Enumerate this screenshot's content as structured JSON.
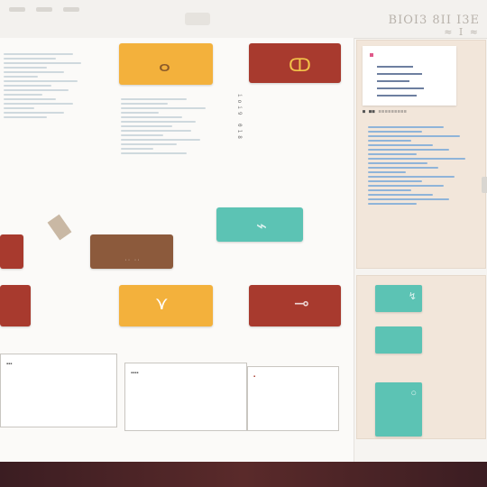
{
  "topbar": {
    "brand_line1": "BIOI3 8II I3E",
    "brand_line2": "≈ I ≈"
  },
  "colors": {
    "card_yellow": "#f3b13c",
    "card_red": "#a83a2e",
    "card_brown": "#8c5a3c",
    "card_teal": "#5cc3b4",
    "panel_beige": "#f2e6da"
  },
  "cards": [
    {
      "icon": "ribbon-icon",
      "glyph": "ⴰ"
    },
    {
      "icon": "ribbon-icon",
      "glyph": "ↀ"
    },
    {
      "icon": "tag-icon",
      "glyph": "⌁"
    },
    {
      "icon": "tag-icon",
      "glyph": "⊶"
    },
    {
      "icon": "ribbon-icon",
      "glyph": "⋎"
    },
    {
      "icon": "tag-icon",
      "glyph": "⊸"
    }
  ],
  "vertical_label": "ioi9 018",
  "sidebar": {
    "toolbar_text": "■ ■■ ≡≡≡≡≡≡≡≡≡",
    "teal_glyph": "↯"
  },
  "progress": {
    "fraction": 0.1
  }
}
